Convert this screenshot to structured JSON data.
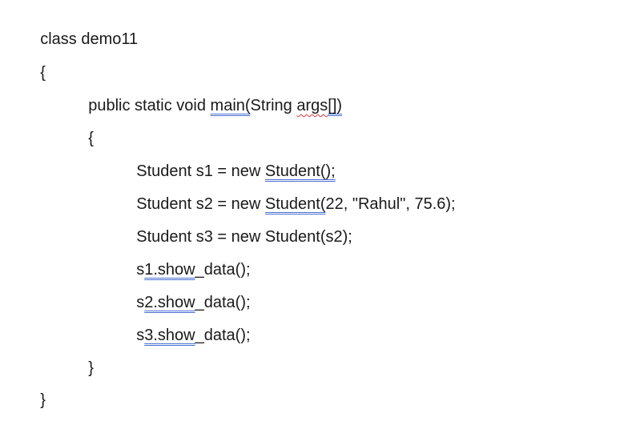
{
  "document": {
    "lines": [
      {
        "indent": 0,
        "segments": [
          {
            "t": "class demo11"
          }
        ]
      },
      {
        "indent": 0,
        "segments": [
          {
            "t": "{"
          }
        ]
      },
      {
        "indent": 1,
        "segments": [
          {
            "t": "public static void "
          },
          {
            "t": "main(",
            "mark": "dbl"
          },
          {
            "t": "String "
          },
          {
            "t": "args",
            "mark": "wavy"
          },
          {
            "t": "[])",
            "mark": "dbl"
          }
        ]
      },
      {
        "indent": 1,
        "segments": [
          {
            "t": "{"
          }
        ]
      },
      {
        "indent": 2,
        "segments": [
          {
            "t": "Student s1 = new "
          },
          {
            "t": "Student();",
            "mark": "dbl"
          }
        ]
      },
      {
        "indent": 2,
        "segments": [
          {
            "t": "Student s2 = new "
          },
          {
            "t": "Student(",
            "mark": "dbl"
          },
          {
            "t": "22, \"Rahul\", 75.6);"
          }
        ]
      },
      {
        "indent": 2,
        "segments": [
          {
            "t": "Student s3 = new Student(s2);"
          }
        ]
      },
      {
        "indent": 2,
        "segments": [
          {
            "t": "s"
          },
          {
            "t": "1.show",
            "mark": "dbl"
          },
          {
            "t": "_data();"
          }
        ]
      },
      {
        "indent": 2,
        "segments": [
          {
            "t": "s"
          },
          {
            "t": "2.show",
            "mark": "dbl"
          },
          {
            "t": "_data();"
          }
        ]
      },
      {
        "indent": 2,
        "segments": [
          {
            "t": "s"
          },
          {
            "t": "3.show",
            "mark": "dbl"
          },
          {
            "t": "_data();"
          }
        ]
      },
      {
        "indent": 1,
        "segments": [
          {
            "t": "}"
          }
        ]
      },
      {
        "indent": 0,
        "segments": [
          {
            "t": "}"
          }
        ]
      }
    ]
  }
}
